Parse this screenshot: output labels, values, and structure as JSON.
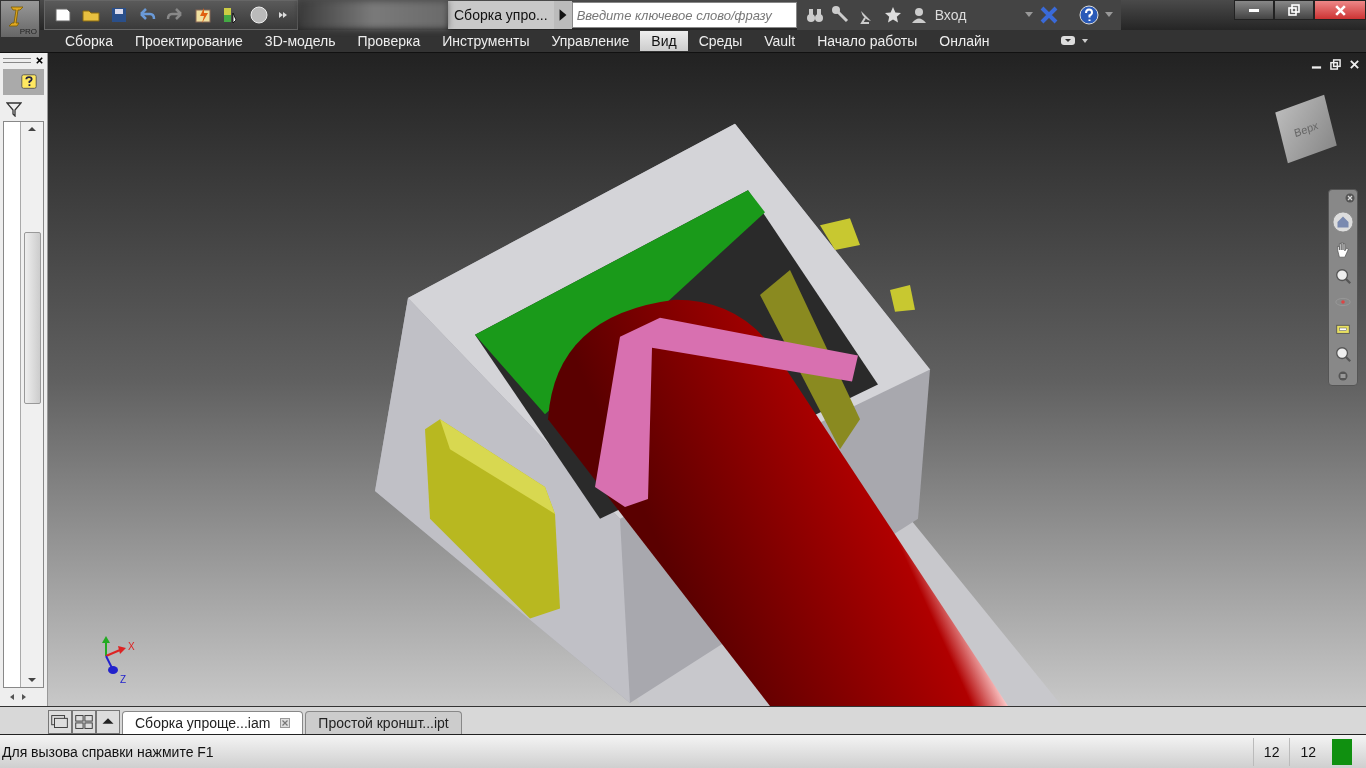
{
  "app_button": {
    "label": "PRO"
  },
  "title_bar": {
    "document_title": "Сборка упро...",
    "search": {
      "placeholder": "Введите ключевое слово/фразу"
    },
    "sign_in": "Вход"
  },
  "ribbon_tabs": [
    {
      "label": "Сборка",
      "selected": false
    },
    {
      "label": "Проектирование",
      "selected": false
    },
    {
      "label": "3D-модель",
      "selected": false
    },
    {
      "label": "Проверка",
      "selected": false
    },
    {
      "label": "Инструменты",
      "selected": false
    },
    {
      "label": "Управление",
      "selected": false
    },
    {
      "label": "Вид",
      "selected": true
    },
    {
      "label": "Среды",
      "selected": false
    },
    {
      "label": "Vault",
      "selected": false
    },
    {
      "label": "Начало работы",
      "selected": false
    },
    {
      "label": "Онлайн",
      "selected": false
    }
  ],
  "viewport": {
    "view_cube": {
      "face_label": "Верх"
    },
    "axis_labels": [
      "X",
      "Z"
    ]
  },
  "document_tabs": [
    {
      "label": "Сборка упроще...iam",
      "selected": true
    },
    {
      "label": "Простой кроншт...ipt",
      "selected": false
    }
  ],
  "status_bar": {
    "message": "Для вызова справки нажмите F1",
    "counters": [
      "12",
      "12"
    ]
  }
}
